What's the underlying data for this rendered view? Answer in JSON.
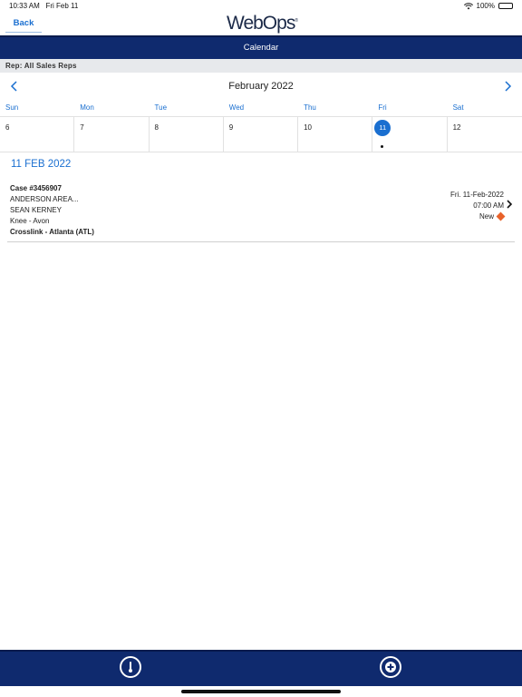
{
  "status_bar": {
    "time": "10:33 AM",
    "date": "Fri Feb 11",
    "battery": "100%"
  },
  "header": {
    "back_label": "Back",
    "logo_text": "WebOps",
    "title": "Calendar"
  },
  "rep_filter": "Rep: All Sales Reps",
  "calendar": {
    "month_title": "February 2022",
    "weekdays": [
      "Sun",
      "Mon",
      "Tue",
      "Wed",
      "Thu",
      "Fri",
      "Sat"
    ],
    "days": [
      "6",
      "7",
      "8",
      "9",
      "10",
      "11",
      "12"
    ],
    "selected_day": "11"
  },
  "selected_date_heading": "11 FEB 2022",
  "cases": [
    {
      "case_number": "Case #3456907",
      "hospital": "ANDERSON AREA...",
      "surgeon": "SEAN KERNEY",
      "procedure": "Knee - Avon",
      "location": "Crosslink - Atlanta (ATL)",
      "date": "Fri. 11-Feb-2022",
      "time": "07:00 AM",
      "status": "New",
      "status_color": "#e8622a"
    }
  ],
  "colors": {
    "accent": "#1a6fd0",
    "navy": "#0f2a6e"
  },
  "bottom_icons": [
    "thermometer-icon",
    "add-icon"
  ]
}
